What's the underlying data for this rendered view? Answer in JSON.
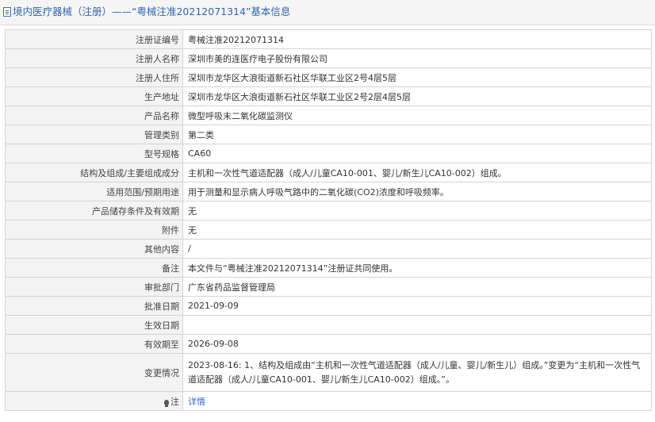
{
  "header": {
    "icon": "document-icon",
    "title": "境内医疗器械（注册）——“粤械注准20212071314”基本信息"
  },
  "rows": [
    {
      "label": "注册证编号",
      "value": "粤械注准20212071314"
    },
    {
      "label": "注册人名称",
      "value": "深圳市美的连医疗电子股份有限公司"
    },
    {
      "label": "注册人住所",
      "value": "深圳市龙华区大浪街道新石社区华联工业区2号4层5层"
    },
    {
      "label": "生产地址",
      "value": "深圳市龙华区大浪街道新石社区华联工业区2号2层4层5层"
    },
    {
      "label": "产品名称",
      "value": "微型呼吸末二氧化碳监测仪"
    },
    {
      "label": "管理类别",
      "value": "第二类"
    },
    {
      "label": "型号规格",
      "value": "CA60"
    },
    {
      "label": "结构及组成/主要组成成分",
      "value": "主机和一次性气道适配器（成人/儿童CA10-001、婴儿/新生儿CA10-002）组成。"
    },
    {
      "label": "适用范围/预期用途",
      "value": "用于测量和显示病人呼吸气路中的二氧化碳(CO2)浓度和呼吸频率。"
    },
    {
      "label": "产品储存条件及有效期",
      "value": "无"
    },
    {
      "label": "附件",
      "value": "无"
    },
    {
      "label": "其他内容",
      "value": "/"
    },
    {
      "label": "备注",
      "value": "本文件与“粤械注准20212071314”注册证共同使用。"
    },
    {
      "label": "审批部门",
      "value": "广东省药品监督管理局"
    },
    {
      "label": "批准日期",
      "value": "2021-09-09"
    },
    {
      "label": "生效日期",
      "value": ""
    },
    {
      "label": "有效期至",
      "value": "2026-09-08"
    },
    {
      "label": "变更情况",
      "value": "2023-08-16: 1、结构及组成由“主机和一次性气道适配器（成人/儿童、婴儿/新生儿）组成。”变更为“主机和一次性气道适配器（成人/儿童CA10-001、婴儿/新生儿CA10-002）组成。”。"
    }
  ],
  "note": {
    "icon": "bulb-icon",
    "label": "注",
    "link_text": "详情"
  },
  "colors": {
    "header_text": "#3366aa",
    "label_bg": "#f3f3f3",
    "border": "#d4d4d4",
    "link": "#3366cc"
  }
}
